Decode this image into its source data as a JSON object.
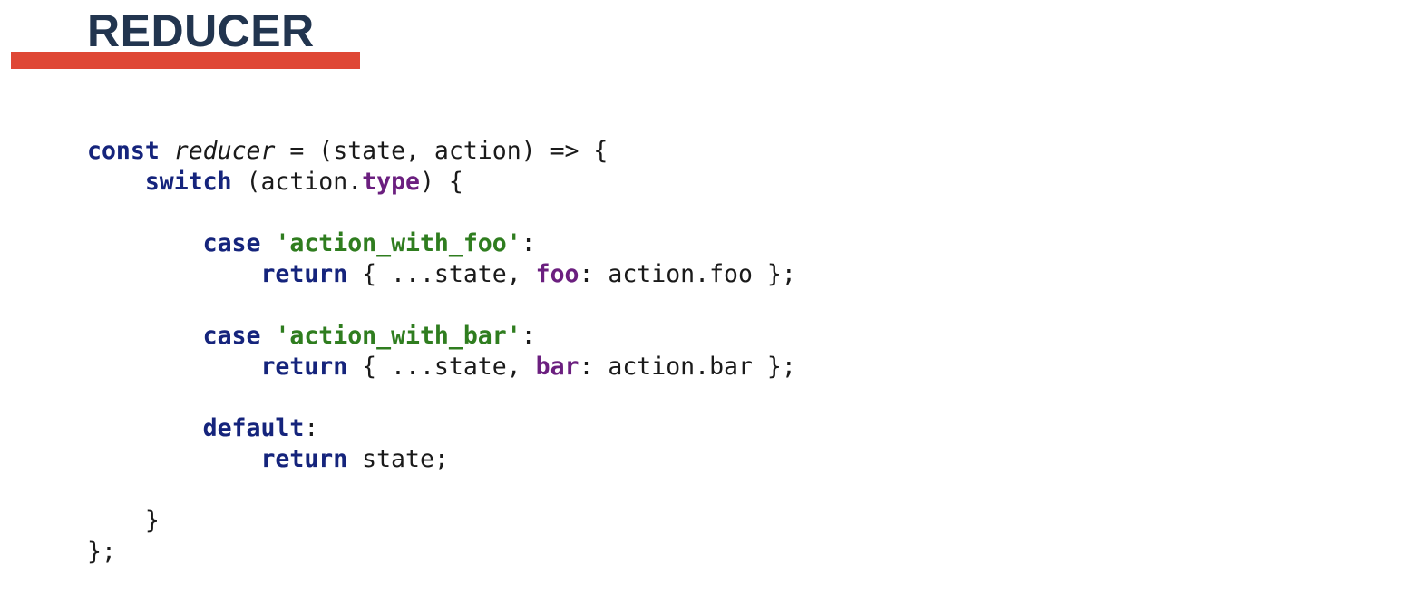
{
  "slide": {
    "title": "REDUCER",
    "accent_color": "#df4735",
    "title_color": "#22354f"
  },
  "code": {
    "language": "javascript",
    "lines": [
      [
        {
          "t": "const",
          "c": "kw"
        },
        {
          "t": " "
        },
        {
          "t": "reducer",
          "c": "ital"
        },
        {
          "t": " = (state, action) => {"
        }
      ],
      [
        {
          "t": "    "
        },
        {
          "t": "switch",
          "c": "kw"
        },
        {
          "t": " (action."
        },
        {
          "t": "type",
          "c": "prop"
        },
        {
          "t": ") {"
        }
      ],
      [],
      [
        {
          "t": "        "
        },
        {
          "t": "case",
          "c": "kw"
        },
        {
          "t": " "
        },
        {
          "t": "'action_with_foo'",
          "c": "str"
        },
        {
          "t": ":"
        }
      ],
      [
        {
          "t": "            "
        },
        {
          "t": "return",
          "c": "kw"
        },
        {
          "t": " { ...state, "
        },
        {
          "t": "foo",
          "c": "prop"
        },
        {
          "t": ": action.foo };"
        }
      ],
      [],
      [
        {
          "t": "        "
        },
        {
          "t": "case",
          "c": "kw"
        },
        {
          "t": " "
        },
        {
          "t": "'action_with_bar'",
          "c": "str"
        },
        {
          "t": ":"
        }
      ],
      [
        {
          "t": "            "
        },
        {
          "t": "return",
          "c": "kw"
        },
        {
          "t": " { ...state, "
        },
        {
          "t": "bar",
          "c": "prop"
        },
        {
          "t": ": action.bar };"
        }
      ],
      [],
      [
        {
          "t": "        "
        },
        {
          "t": "default",
          "c": "kw"
        },
        {
          "t": ":"
        }
      ],
      [
        {
          "t": "            "
        },
        {
          "t": "return",
          "c": "kw"
        },
        {
          "t": " state;"
        }
      ],
      [],
      [
        {
          "t": "    }"
        }
      ],
      [
        {
          "t": "};"
        }
      ]
    ]
  }
}
